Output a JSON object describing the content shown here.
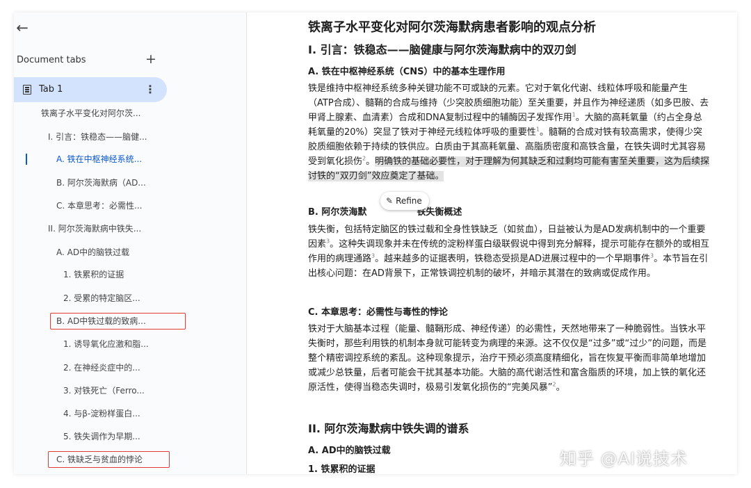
{
  "sidebar": {
    "back_icon": "←",
    "heading": "Document tabs",
    "add_icon": "+",
    "tab": {
      "label": "Tab 1",
      "more_icon": "⋮"
    },
    "outline": [
      "铁离子水平变化对阿尔茨...",
      "I. 引言：铁稳态——脑健...",
      "A. 铁在中枢神经系统...",
      "B. 阿尔茨海默病（AD...",
      "C. 本章思考：必需性...",
      "II. 阿尔茨海默病中铁失...",
      "A. AD中的脑铁过载",
      "1. 铁累积的证据",
      "2. 受累的特定脑区...",
      "B. AD中铁过载的致病...",
      "1. 诱导氧化应激和脂...",
      "2. 在神经炎症中的...",
      "3. 对铁死亡（Ferro...",
      "4. 与β-淀粉样蛋白...",
      "5. 铁失调作为早期...",
      "C. 铁缺乏与贫血的悖论"
    ]
  },
  "document": {
    "title": "铁离子水平变化对阿尔茨海默病患者影响的观点分析",
    "section1": "I. 引言：铁稳态——脑健康与阿尔茨海默病中的双刃剑",
    "sub_a": "A. 铁在中枢神经系统（CNS）中的基本生理作用",
    "para_a_1": "铁是维持中枢神经系统多种关键功能不可或缺的元素。它对于氧化代谢、线粒体呼吸和能量产生（ATP合成）、髓鞘的合成与维持（少突胶质细胞功能）至关重要，并且作为神经递质（如多巴胺、去甲肾上腺素、血清素）合成和DNA复制过程中的辅酶因子发挥作用",
    "ref_1a": "1",
    "para_a_2": "。大脑的高耗氧量（约占全身总耗氧量的20%）突显了铁对于神经元线粒体呼吸的重要性",
    "ref_1b": "1",
    "para_a_3": "。髓鞘的合成对铁有较高需求，使得少突胶质细胞依赖于持续的铁供应。白质由于其高耗氧量、高脂质密度和高铁含量，在铁失调时尤其容易受到氧化损伤",
    "ref_2": "2",
    "para_a_4": "。",
    "para_a_highlight": "明确铁的基础必要性，对于理解为何其缺乏和过剩均可能有害至关重要，这为后续探讨铁的“双刃剑”效应奠定了基础。",
    "sub_b_left": "B. 阿尔茨海默",
    "sub_b_right": "铁失衡概述",
    "para_b_1": "铁失衡，包括特定脑区的铁过载和全身性铁缺乏（如贫血），日益被认为是AD发病机制中的一个重要因素",
    "ref_3a": "3",
    "para_b_2": "。这种失调现象并未在传统的淀粉样蛋白级联假说中得到充分解释，提示可能存在额外的或相互作用的病理通路",
    "ref_3b": "3",
    "para_b_3": "。越来越多的证据表明，铁稳态受损是AD进展过程中的一个早期事件",
    "ref_3c": "3",
    "para_b_4": "。本节旨在引出核心问题：在AD背景下，正常铁调控机制的破坏，并暗示其潜在的致病或促成作用。",
    "sub_c": "C. 本章思考：必需性与毒性的悖论",
    "para_c_1": "铁对于大脑基本过程（能量、髓鞘形成、神经传递）的必需性，天然地带来了一种脆弱性。当铁水平失衡时，那些利用铁的机制本身就可能转变为病理的来源。这不仅仅是“过多”或“过少”的问题，而是整个精密调控系统的紊乱。这种现象提示，治疗干预必须高度精细化，旨在恢复平衡而非简单地增加或减少总铁量，后者可能会干扰其基本功能。大脑的高代谢活性和富含脂质的环境，加上铁的氧化还原活性，使得当稳态失调时，极易引发氧化损伤的“完美风暴”",
    "ref_2b": "2",
    "para_c_2": "。",
    "section2": "II. 阿尔茨海默病中铁失调的谱系",
    "sub_2a": "A. AD中的脑铁过载",
    "sub_2a1": "1. 铁累积的证据"
  },
  "refine_button": {
    "icon": "✎",
    "label": "Refine"
  },
  "watermark": "知乎 @AI说技术",
  "colors": {
    "accent": "#0b57d0",
    "tab_highlight": "#d3e3fd",
    "annotation_box": "#e53935",
    "text_highlight": "#e3e3e3"
  }
}
